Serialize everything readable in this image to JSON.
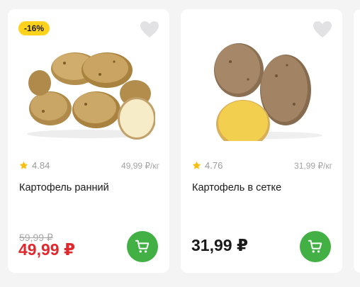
{
  "colors": {
    "discount_badge": "#ffd21c",
    "sale_price": "#e0282f",
    "cart_button": "#43b046",
    "rating_star": "#f6c012"
  },
  "products": [
    {
      "discount": "-16%",
      "rating": "4.84",
      "unit_price": "49,99 ₽/кг",
      "title": "Картофель ранний",
      "old_price": "59,99 ₽",
      "price": "49,99 ₽",
      "image_icon": "young-potatoes-image",
      "favorite_icon": "heart-icon",
      "cart_icon": "cart-icon"
    },
    {
      "rating": "4.76",
      "unit_price": "31,99 ₽/кг",
      "title": "Картофель в сетке",
      "price": "31,99 ₽",
      "image_icon": "potatoes-image",
      "favorite_icon": "heart-icon",
      "cart_icon": "cart-icon"
    }
  ]
}
